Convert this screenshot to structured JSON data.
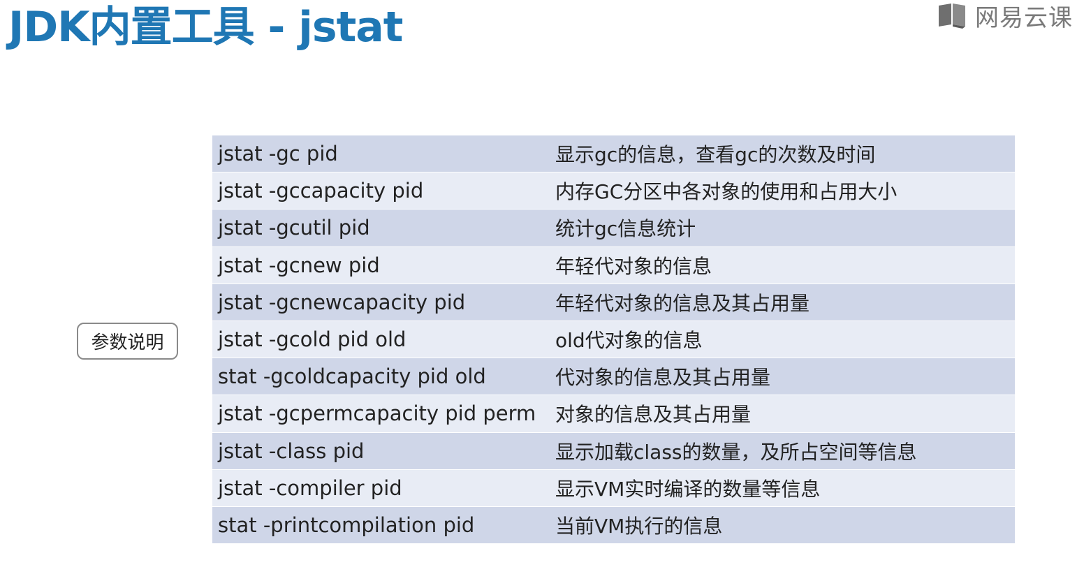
{
  "slide": {
    "title": "JDK内置工具 - jstat",
    "brand_text": "网易云课",
    "brand_icon": "book-icon",
    "param_label": "参数说明",
    "colors": {
      "title": "#1f77b4",
      "row_dark": "#cfd6e8",
      "row_light": "#e8ecf5"
    }
  },
  "table": {
    "rows": [
      {
        "command": "jstat -gc pid",
        "description": "显示gc的信息，查看gc的次数及时间"
      },
      {
        "command": "jstat -gccapacity pid",
        "description": "内存GC分区中各对象的使用和占用大小"
      },
      {
        "command": "jstat -gcutil pid",
        "description": "统计gc信息统计"
      },
      {
        "command": "jstat -gcnew pid",
        "description": "年轻代对象的信息"
      },
      {
        "command": "jstat -gcnewcapacity pid",
        "description": "年轻代对象的信息及其占用量"
      },
      {
        "command": "jstat -gcold pid  old",
        "description": "old代对象的信息"
      },
      {
        "command": "stat -gcoldcapacity pid old",
        "description": "代对象的信息及其占用量"
      },
      {
        "command": "jstat -gcpermcapacity pid perm",
        "description": "对象的信息及其占用量"
      },
      {
        "command": "jstat -class pid",
        "description": "显示加载class的数量，及所占空间等信息"
      },
      {
        "command": "jstat -compiler pid",
        "description": "显示VM实时编译的数量等信息"
      },
      {
        "command": "stat -printcompilation pid",
        "description": "当前VM执行的信息"
      }
    ]
  }
}
